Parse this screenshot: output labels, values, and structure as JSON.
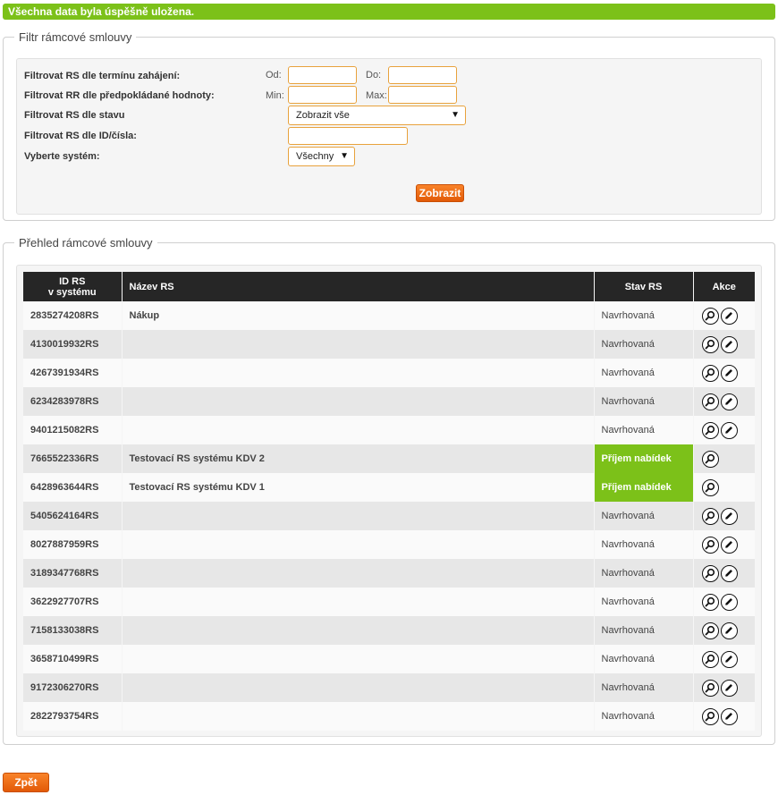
{
  "notification": {
    "success_text": "Všechna data byla úspěšně uložena."
  },
  "filter": {
    "legend": "Filtr rámcové smlouvy",
    "rows": {
      "start_term": {
        "label": "Filtrovat RS dle termínu zahájení:",
        "from_label": "Od:",
        "to_label": "Do:",
        "from_value": "",
        "to_value": ""
      },
      "expected_value": {
        "label": "Filtrovat RR dle předpokládané hodnoty:",
        "min_label": "Min:",
        "max_label": "Max:",
        "min_value": "",
        "max_value": ""
      },
      "state": {
        "label": "Filtrovat RS dle stavu",
        "selected": "Zobrazit vše"
      },
      "id_number": {
        "label": "Filtrovat RS dle ID/čísla:",
        "value": ""
      },
      "system": {
        "label": "Vyberte systém:",
        "selected": "Všechny"
      }
    },
    "submit_label": "Zobrazit"
  },
  "overview": {
    "legend": "Přehled rámcové smlouvy",
    "columns": {
      "id_line1": "ID RS",
      "id_line2": "v systému",
      "name": "Název RS",
      "state": "Stav RS",
      "actions": "Akce"
    },
    "rows": [
      {
        "id": "2835274208RS",
        "name": "Nákup",
        "state": "Navrhovaná",
        "editable": true
      },
      {
        "id": "4130019932RS",
        "name": "",
        "state": "Navrhovaná",
        "editable": true
      },
      {
        "id": "4267391934RS",
        "name": "",
        "state": "Navrhovaná",
        "editable": true
      },
      {
        "id": "6234283978RS",
        "name": "",
        "state": "Navrhovaná",
        "editable": true
      },
      {
        "id": "9401215082RS",
        "name": "",
        "state": "Navrhovaná",
        "editable": true
      },
      {
        "id": "7665522336RS",
        "name": "Testovací RS systému KDV 2",
        "state": "Příjem nabídek",
        "editable": false
      },
      {
        "id": "6428963644RS",
        "name": "Testovací RS systému KDV 1",
        "state": "Příjem nabídek",
        "editable": false
      },
      {
        "id": "5405624164RS",
        "name": "",
        "state": "Navrhovaná",
        "editable": true
      },
      {
        "id": "8027887959RS",
        "name": "",
        "state": "Navrhovaná",
        "editable": true
      },
      {
        "id": "3189347768RS",
        "name": "",
        "state": "Navrhovaná",
        "editable": true
      },
      {
        "id": "3622927707RS",
        "name": "",
        "state": "Navrhovaná",
        "editable": true
      },
      {
        "id": "7158133038RS",
        "name": "",
        "state": "Navrhovaná",
        "editable": true
      },
      {
        "id": "3658710499RS",
        "name": "",
        "state": "Navrhovaná",
        "editable": true
      },
      {
        "id": "9172306270RS",
        "name": "",
        "state": "Navrhovaná",
        "editable": true
      },
      {
        "id": "2822793754RS",
        "name": "",
        "state": "Navrhovaná",
        "editable": true
      }
    ]
  },
  "back_label": "Zpět",
  "colors": {
    "success_green": "#7cc119",
    "accent_orange": "#f06e14",
    "input_border": "#e8a23c",
    "header_dark": "#262626"
  },
  "icons": {
    "detail": "magnifier-icon",
    "edit": "pencil-icon",
    "dropdown": "triangle-down-icon"
  }
}
